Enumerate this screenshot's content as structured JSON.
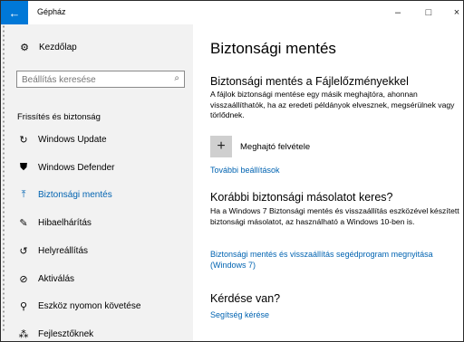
{
  "window": {
    "title": "Gépház",
    "back_icon": "←",
    "minimize": "–",
    "maximize": "□",
    "close": "×"
  },
  "sidebar": {
    "home": {
      "icon": "⚙",
      "label": "Kezdőlap"
    },
    "search": {
      "placeholder": "Beállítás keresése",
      "icon": "⌕"
    },
    "section": "Frissítés és biztonság",
    "items": [
      {
        "icon": "↻",
        "label": "Windows Update",
        "active": false
      },
      {
        "icon": "⛊",
        "label": "Windows Defender",
        "active": false
      },
      {
        "icon": "⤒",
        "label": "Biztonsági mentés",
        "active": true
      },
      {
        "icon": "✎",
        "label": "Hibaelhárítás",
        "active": false
      },
      {
        "icon": "↺",
        "label": "Helyreállítás",
        "active": false
      },
      {
        "icon": "⊘",
        "label": "Aktiválás",
        "active": false
      },
      {
        "icon": "⚲",
        "label": "Eszköz nyomon követése",
        "active": false
      },
      {
        "icon": "⁂",
        "label": "Fejlesztőknek",
        "active": false
      }
    ]
  },
  "main": {
    "title": "Biztonsági mentés",
    "file_history": {
      "heading": "Biztonsági mentés a Fájlelőzményekkel",
      "text": "A fájlok biztonsági mentése egy másik meghajtóra, ahonnan visszaállíthatók, ha az eredeti példányok elvesznek, megsérülnek vagy törlődnek.",
      "add_drive_icon": "+",
      "add_drive_label": "Meghajtó felvétele",
      "more_settings": "További beállítások"
    },
    "older_backup": {
      "heading": "Korábbi biztonsági másolatot keres?",
      "text": "Ha a Windows 7 Biztonsági mentés és visszaállítás eszközével készített biztonsági másolatot, az használható a Windows 10-ben is.",
      "link": "Biztonsági mentés és visszaállítás segédprogram megnyitása (Windows 7)"
    },
    "question": {
      "heading": "Kérdése van?",
      "link": "Segítség kérése"
    }
  },
  "colors": {
    "accent": "#0078d7",
    "link": "#0063b1",
    "sidebar_bg": "#f2f2f2"
  }
}
